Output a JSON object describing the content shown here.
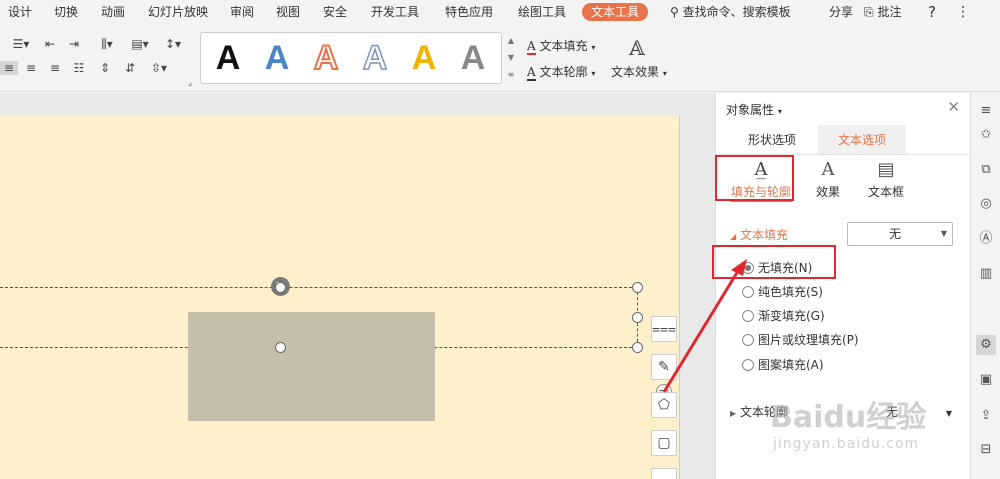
{
  "menubar": {
    "items": [
      "设计",
      "切换",
      "动画",
      "幻灯片放映",
      "审阅",
      "视图",
      "安全",
      "开发工具",
      "特色应用",
      "绘图工具",
      "文本工具"
    ],
    "search_placeholder": "查找命令、搜索模板",
    "share": "分享",
    "comment": "批注",
    "help": "?",
    "more": "⋮"
  },
  "ribbon": {
    "wordart_letters": [
      "A",
      "A",
      "A",
      "A",
      "A",
      "A"
    ],
    "wordart_colors": [
      "#111111",
      "#4a86c8",
      "#e8734a",
      "#7a93b8",
      "#f0b400",
      "#777777"
    ],
    "text_fill_label": "文本填充",
    "text_outline_label": "文本轮廓",
    "text_effect_label": "文本效果"
  },
  "panel": {
    "title": "对象属性",
    "tabs": [
      "形状选项",
      "文本选项"
    ],
    "subtabs": [
      "填充与轮廓",
      "效果",
      "文本框"
    ],
    "section_fill": "文本填充",
    "fill_value": "无",
    "radio_options": [
      "无填充(N)",
      "纯色填充(S)",
      "渐变填充(G)",
      "图片或纹理填充(P)",
      "图案填充(A)"
    ],
    "section_outline": "文本轮廓",
    "outline_value": "无"
  },
  "watermark": {
    "brand": "Baidu经验",
    "url": "jingyan.baidu.com"
  },
  "colors": {
    "accent": "#e8734a",
    "annotation_red": "#e0282e",
    "slide_bg": "#fff0cc",
    "shape_fill": "#c5beab"
  }
}
